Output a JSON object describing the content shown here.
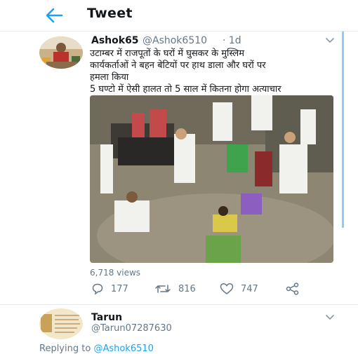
{
  "header": {
    "title": "Tweet"
  },
  "tweet": {
    "author_name": "Ashok65",
    "author_handle": "@Ashok6510",
    "time": "· 1d",
    "text_lines": [
      "उटाम्बर में राजपूतों के घरों में घुसकर के मुस्लिम",
      "कार्यकर्ताओं ने बहन बेटियों पर हाथ डाला और घरों पर",
      "हमला किया",
      "5 घण्टो में ऐसी हालत तो 5 साल में कितना होगा अत्याचार"
    ],
    "views": "6,718 views",
    "replies": "177",
    "retweets": "816",
    "likes": "747"
  },
  "reply": {
    "name": "Tarun",
    "handle": "@Tarun07287630",
    "replying_prefix": "Replying to ",
    "replying_to": "@Ashok6510"
  },
  "icons": {
    "back": "arrow-left-icon",
    "caret": "chevron-down-icon",
    "reply": "comment-icon",
    "retweet": "retweet-icon",
    "like": "heart-icon",
    "share": "share-icon"
  },
  "colors": {
    "accent": "#1da1f2",
    "text": "#14171a",
    "muted": "#657786"
  }
}
